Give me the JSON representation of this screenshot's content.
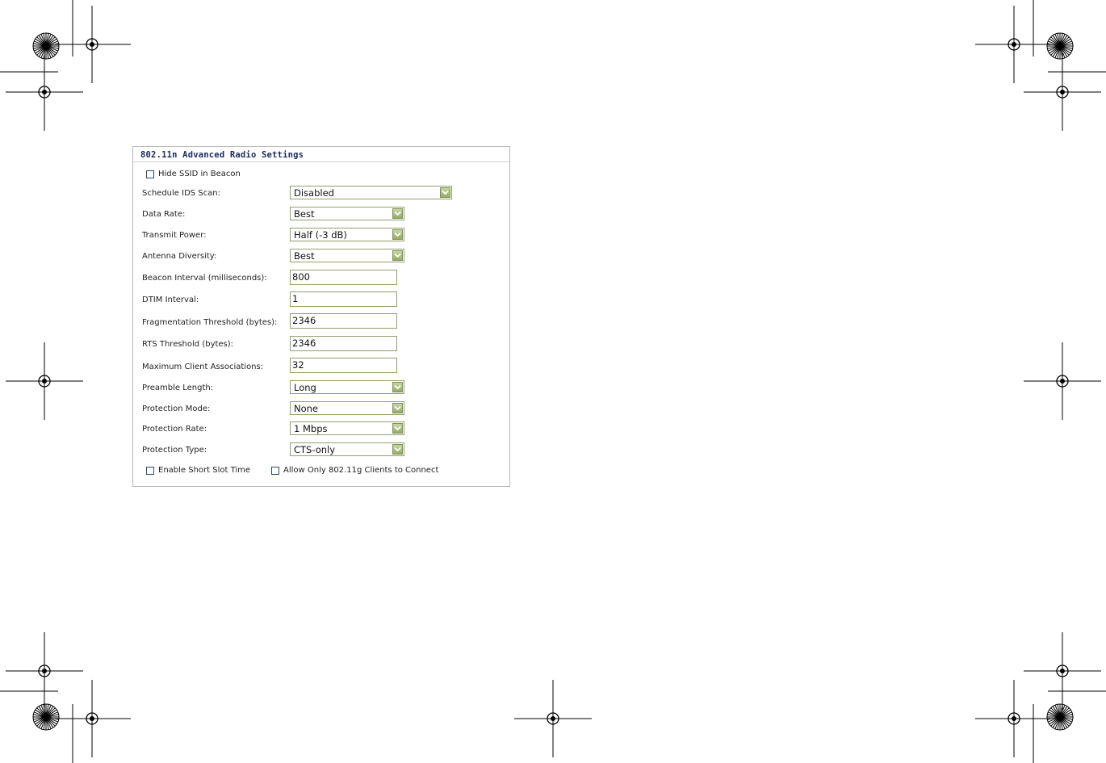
{
  "panel": {
    "title": "802.11n Advanced Radio Settings",
    "hide_ssid_label": "Hide SSID in Beacon",
    "hide_ssid_checked": false,
    "fields": {
      "schedule_ids": {
        "label": "Schedule IDS Scan:",
        "value": "Disabled"
      },
      "data_rate": {
        "label": "Data Rate:",
        "value": "Best"
      },
      "transmit_power": {
        "label": "Transmit Power:",
        "value": "Half (-3 dB)"
      },
      "antenna_diversity": {
        "label": "Antenna Diversity:",
        "value": "Best"
      },
      "beacon_interval": {
        "label": "Beacon Interval (milliseconds):",
        "value": "800"
      },
      "dtim_interval": {
        "label": "DTIM Interval:",
        "value": "1"
      },
      "frag_threshold": {
        "label": "Fragmentation Threshold (bytes):",
        "value": "2346"
      },
      "rts_threshold": {
        "label": "RTS Threshold (bytes):",
        "value": "2346"
      },
      "max_clients": {
        "label": "Maximum Client Associations:",
        "value": "32"
      },
      "preamble_length": {
        "label": "Preamble Length:",
        "value": "Long"
      },
      "protection_mode": {
        "label": "Protection Mode:",
        "value": "None"
      },
      "protection_rate": {
        "label": "Protection Rate:",
        "value": "1 Mbps"
      },
      "protection_type": {
        "label": "Protection Type:",
        "value": "CTS-only"
      }
    },
    "short_slot_label": "Enable Short Slot Time",
    "short_slot_checked": false,
    "only_11g_label": "Allow Only 802.11g Clients to Connect",
    "only_11g_checked": false
  },
  "icons": {
    "dropdown": "chevron-down-icon",
    "crop_mark": "registration-mark-icon",
    "star_target": "starburst-target-icon"
  }
}
